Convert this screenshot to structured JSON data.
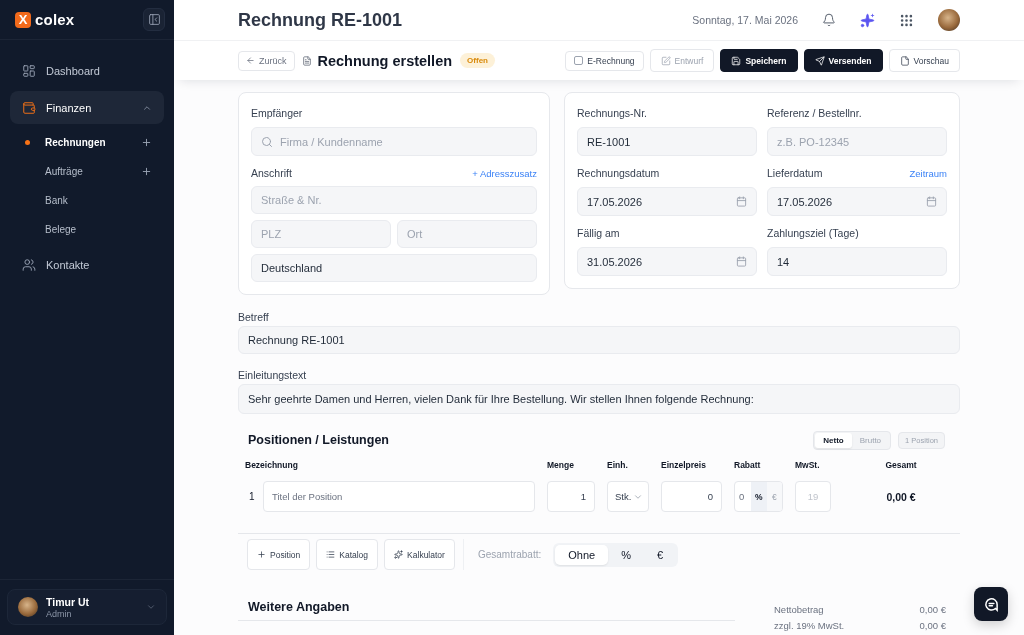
{
  "sidebar": {
    "brand": {
      "letter": "X",
      "name": "colex"
    },
    "nav": [
      {
        "kind": "link",
        "label": "Dashboard",
        "selected": false
      },
      {
        "kind": "group",
        "label": "Finanzen",
        "selected": true,
        "expanded": true,
        "children": [
          {
            "label": "Rechnungen",
            "selected": true,
            "add": true
          },
          {
            "label": "Aufträge",
            "selected": false,
            "add": true
          },
          {
            "label": "Bank",
            "selected": false,
            "add": false
          },
          {
            "label": "Belege",
            "selected": false,
            "add": false
          }
        ]
      },
      {
        "kind": "link",
        "label": "Kontakte",
        "selected": false
      }
    ],
    "user": {
      "name": "Timur Ut",
      "role": "Admin"
    }
  },
  "header": {
    "title": "Rechnung RE-1001",
    "date": "Sonntag, 17. Mai 2026"
  },
  "toolbar": {
    "back": "Zurück",
    "title": "Rechnung erstellen",
    "status": "Offen",
    "e_invoice": {
      "label": "E-Rechnung",
      "checked": false
    },
    "actions": [
      {
        "kind": "outline",
        "label": "Entwurf",
        "disabled": true
      },
      {
        "kind": "primary",
        "label": "Speichern",
        "disabled": false
      },
      {
        "kind": "primary",
        "label": "Versenden",
        "disabled": false
      },
      {
        "kind": "outline",
        "label": "Vorschau",
        "disabled": false
      }
    ]
  },
  "recipient": {
    "title": "Empfänger",
    "search": {
      "placeholder": "Firma / Kundenname"
    },
    "address": {
      "label": "Anschrift",
      "link": "+ Adresszusatz"
    },
    "street": {
      "placeholder": "Straße & Nr."
    },
    "zip": {
      "placeholder": "PLZ"
    },
    "city": {
      "placeholder": "Ort"
    },
    "country": {
      "value": "Deutschland"
    }
  },
  "details": {
    "fields": [
      {
        "kind": "text",
        "label": "Rechnungs-Nr.",
        "value": "RE-1001"
      },
      {
        "kind": "text",
        "label": "Referenz / Bestellnr.",
        "placeholder": "z.B. PO-12345"
      },
      {
        "kind": "date",
        "label": "Rechnungsdatum",
        "value": "17.05.2026"
      },
      {
        "kind": "date",
        "label": "Lieferdatum",
        "value": "17.05.2026",
        "link": "Zeitraum"
      },
      {
        "kind": "date",
        "label": "Fällig am",
        "value": "31.05.2026"
      },
      {
        "kind": "text",
        "label": "Zahlungsziel (Tage)",
        "value": "14"
      }
    ]
  },
  "subject": {
    "label": "Betreff",
    "value": "Rechnung RE-1001"
  },
  "intro": {
    "label": "Einleitungstext",
    "value": "Sehr geehrte Damen und Herren, vielen Dank für Ihre Bestellung. Wir stellen Ihnen folgende Rechnung:"
  },
  "positions": {
    "title": "Positionen / Leistungen",
    "price_mode": [
      {
        "label": "Netto",
        "selected": true
      },
      {
        "label": "Brutto",
        "selected": false
      }
    ],
    "count": "1 Position",
    "columns": [
      "Bezeichnung",
      "Menge",
      "Einh.",
      "Einzelpreis",
      "Rabatt",
      "MwSt.",
      "Gesamt"
    ],
    "rows": [
      {
        "number": "1",
        "title": {
          "placeholder": "Titel der Position"
        },
        "quantity": "1",
        "unit": "Stk.",
        "unit_price": "0",
        "discount": {
          "value": "0",
          "modes": [
            {
              "label": "%",
              "selected": true
            },
            {
              "label": "€",
              "selected": false
            }
          ]
        },
        "vat": {
          "placeholder": "19"
        },
        "total": "0,00 €"
      }
    ],
    "actions": [
      "Position",
      "Katalog",
      "Kalkulator"
    ],
    "total_discount": {
      "label": "Gesamtrabatt:",
      "options": [
        {
          "label": "Ohne",
          "selected": true
        },
        {
          "label": "%",
          "selected": false
        },
        {
          "label": "€",
          "selected": false
        }
      ]
    }
  },
  "extras": {
    "title": "Weitere Angaben"
  },
  "totals": [
    {
      "label": "Nettobetrag",
      "value": "0,00 €"
    },
    {
      "label": "zzgl. 19% MwSt.",
      "value": "0,00 €"
    }
  ]
}
